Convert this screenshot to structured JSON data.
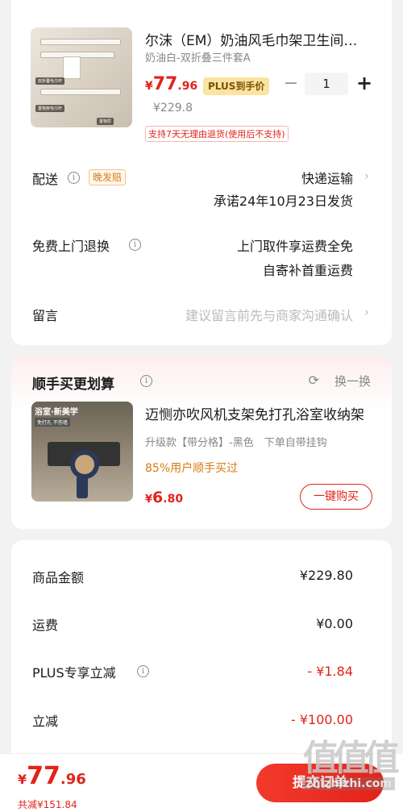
{
  "product": {
    "title": "尔沫（EM）奶油风毛巾架卫生间置物架",
    "spec": "奶油白-双折叠三件套A",
    "price_currency": "¥",
    "price_int": "77",
    "price_dec": ".96",
    "plus_badge": "PLUS到手价",
    "original_price": "¥229.8",
    "quantity": "1",
    "minus": "−",
    "plus": "+",
    "return_policy": "支持7天无理由退货(使用后不支持)",
    "image_tags": [
      "双折叠毛巾杆",
      "置物架毛巾杆",
      "置物层"
    ]
  },
  "delivery": {
    "label": "配送",
    "badge": "晚发赔",
    "method": "快递运输",
    "promise": "承诺24年10月23日发货"
  },
  "returns": {
    "label": "免费上门退换",
    "line1": "上门取件享运费全免",
    "line2": "自寄补首重运费"
  },
  "message": {
    "label": "留言",
    "placeholder": "建议留言前先与商家沟通确认"
  },
  "addon": {
    "title": "顺手买更划算",
    "refresh": "换一换",
    "image_label": "浴室·新美学",
    "image_sub": "免打孔 不伤墙",
    "product_title": "迈恻亦吹风机支架免打孔浴室收纳架",
    "spec": "升级款【带分格】-黑色　下单自带挂钩",
    "percent": "85%用户顺手买过",
    "price_currency": "¥",
    "price_int": "6",
    "price_dec": ".80",
    "buy_button": "一键购买"
  },
  "summary": {
    "rows": [
      {
        "label": "商品金额",
        "value": "¥229.80"
      },
      {
        "label": "运费",
        "value": "¥0.00"
      },
      {
        "label": "PLUS专享立减",
        "value": "- ¥1.84"
      },
      {
        "label": "立减",
        "value": "- ¥100.00"
      }
    ]
  },
  "footer": {
    "total_currency": "¥",
    "total_int": "77",
    "total_dec": ".96",
    "saved": "共减¥151.84",
    "submit": "提交订单"
  },
  "watermark": {
    "mark": "值值值",
    "site": "zhizhizhi.com"
  },
  "colors": {
    "accent": "#e2231a",
    "plus_gold": "#fbe3a1",
    "orange": "#d77b12"
  }
}
